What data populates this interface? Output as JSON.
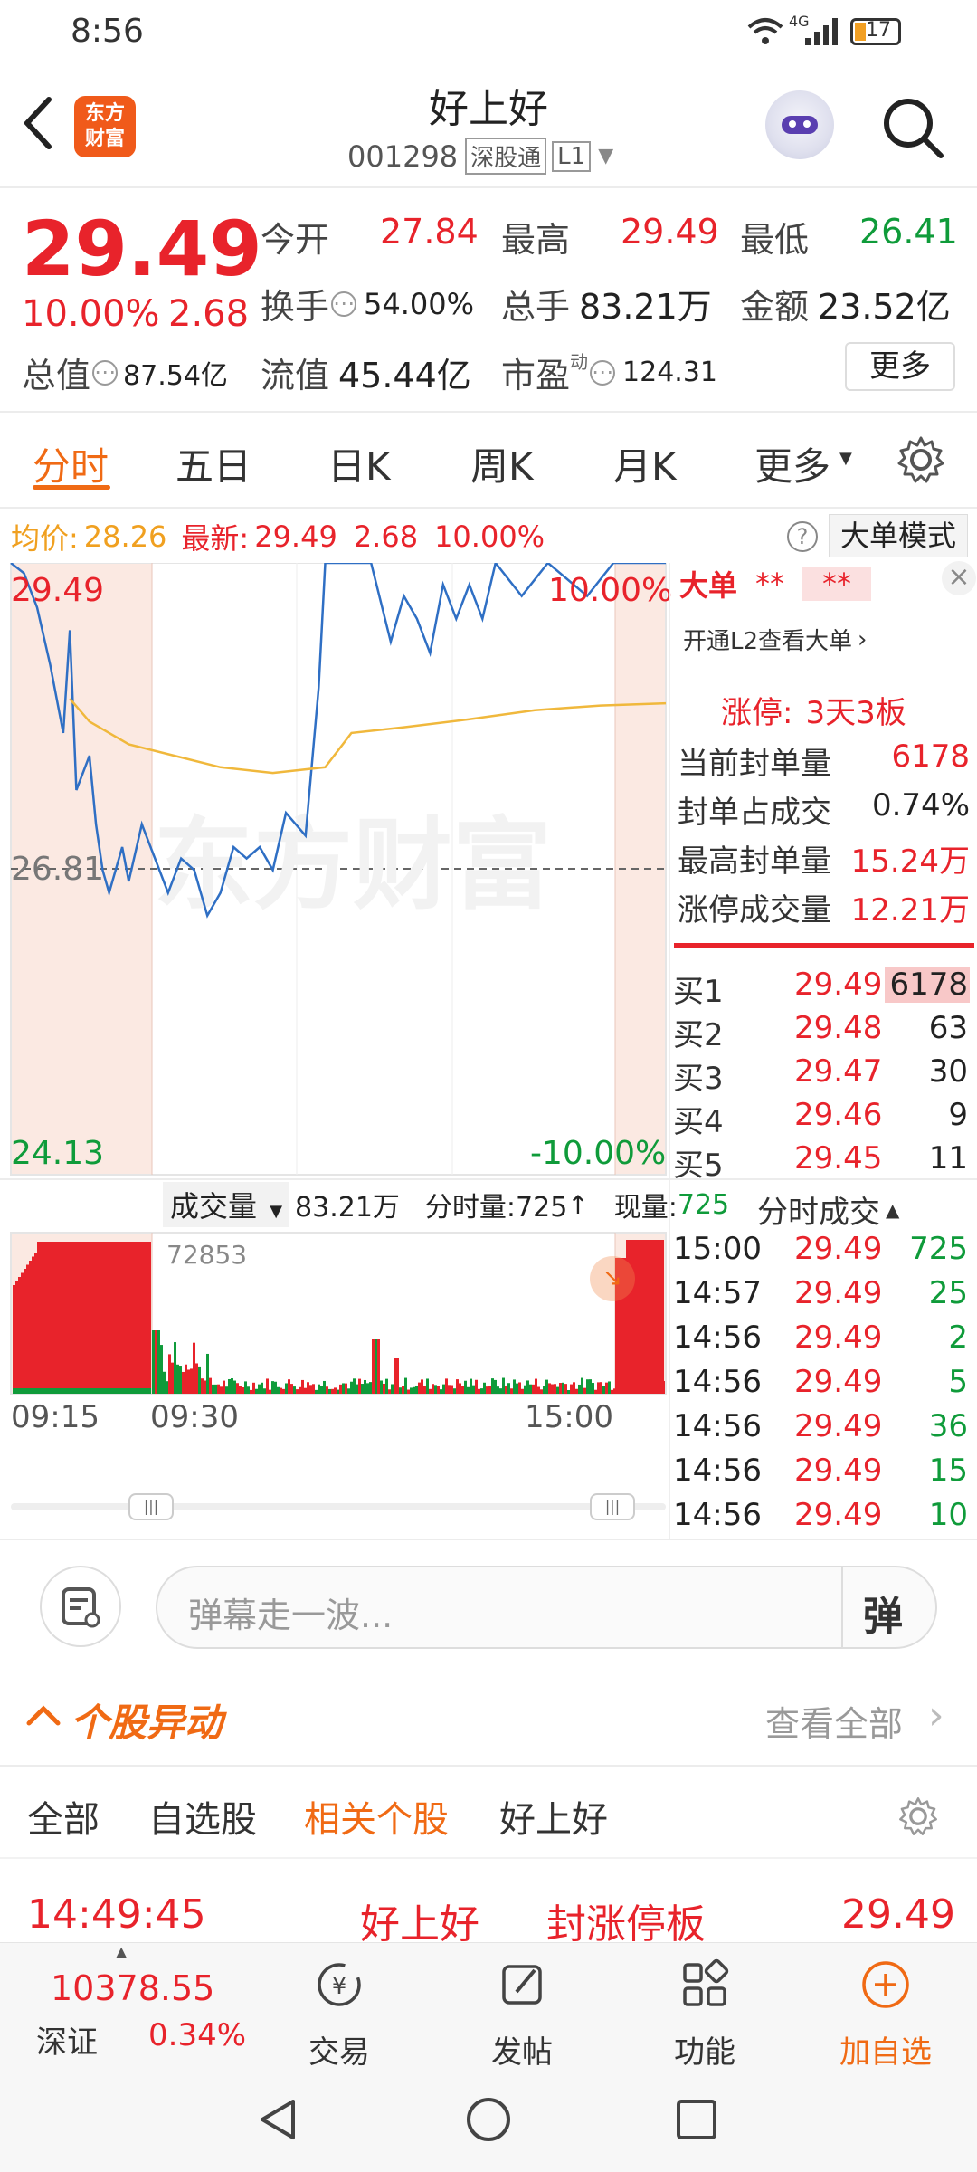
{
  "status_bar": {
    "time": "8:56",
    "network": "4G",
    "battery": "17"
  },
  "header": {
    "logo_line1": "东方",
    "logo_line2": "财富",
    "title": "好上好",
    "code": "001298",
    "exchange_tag": "深股通",
    "level_tag": "L1"
  },
  "quote": {
    "price": "29.49",
    "change_pct": "10.00%",
    "change": "2.68",
    "open_label": "今开",
    "open": "27.84",
    "high_label": "最高",
    "high": "29.49",
    "low_label": "最低",
    "low": "26.41",
    "turnover_label": "换手",
    "turnover": "54.00%",
    "volume_label": "总手",
    "volume": "83.21万",
    "amount_label": "金额",
    "amount": "23.52亿",
    "mcap_label": "总值",
    "mcap": "87.54亿",
    "float_label": "流值",
    "float": "45.44亿",
    "pe_label": "市盈",
    "pe_sup": "动",
    "pe": "124.31",
    "more_button": "更多"
  },
  "chart_tabs": [
    "分时",
    "五日",
    "日K",
    "周K",
    "月K",
    "更多"
  ],
  "info_bar": {
    "avg_label": "均价:",
    "avg": "28.26",
    "latest_label": "最新:",
    "latest": "29.49",
    "chg": "2.68",
    "pct": "10.00%",
    "mode_button": "大单模式"
  },
  "chart_labels": {
    "top_price": "29.49",
    "top_pct": "10.00%",
    "mid_price": "26.81",
    "bottom_price": "24.13",
    "bottom_pct": "-10.00%",
    "vol_selector": "成交量",
    "vol_total": "83.21万",
    "vol_min_label": "分时量:725",
    "vol_now_label": "现量:",
    "vol_now": "725",
    "vol_max": "72853",
    "time_start": "09:15",
    "time_open": "09:30",
    "time_end": "15:00"
  },
  "chart_data": {
    "type": "line",
    "title": "",
    "ylim": [
      24.13,
      29.49
    ],
    "reference": 26.81,
    "series": [
      {
        "name": "",
        "points": [
          [
            0,
            29.49
          ],
          [
            0.02,
            29.4
          ],
          [
            0.04,
            29.1
          ],
          [
            0.06,
            28.6
          ],
          [
            0.08,
            28.0
          ],
          [
            0.09,
            28.9
          ],
          [
            0.1,
            27.5
          ],
          [
            0.12,
            27.8
          ],
          [
            0.13,
            27.2
          ],
          [
            0.14,
            26.8
          ],
          [
            0.15,
            26.6
          ],
          [
            0.17,
            27.0
          ],
          [
            0.18,
            26.7
          ],
          [
            0.2,
            27.2
          ],
          [
            0.22,
            26.9
          ],
          [
            0.24,
            26.6
          ],
          [
            0.26,
            26.9
          ],
          [
            0.28,
            26.8
          ],
          [
            0.3,
            26.4
          ],
          [
            0.32,
            26.6
          ],
          [
            0.34,
            27.0
          ],
          [
            0.36,
            26.9
          ],
          [
            0.38,
            27.0
          ],
          [
            0.4,
            26.8
          ],
          [
            0.42,
            27.3
          ],
          [
            0.45,
            27.1
          ],
          [
            0.47,
            28.4
          ],
          [
            0.48,
            29.49
          ],
          [
            0.52,
            29.49
          ],
          [
            0.55,
            29.49
          ],
          [
            0.58,
            28.8
          ],
          [
            0.6,
            29.2
          ],
          [
            0.62,
            29.0
          ],
          [
            0.64,
            28.7
          ],
          [
            0.66,
            29.3
          ],
          [
            0.68,
            29.0
          ],
          [
            0.7,
            29.3
          ],
          [
            0.72,
            29.0
          ],
          [
            0.74,
            29.49
          ],
          [
            0.78,
            29.2
          ],
          [
            0.82,
            29.49
          ],
          [
            0.88,
            29.2
          ],
          [
            0.92,
            29.49
          ],
          [
            1,
            29.49
          ]
        ]
      },
      {
        "name": "",
        "points": [
          [
            0.09,
            28.3
          ],
          [
            0.12,
            28.1
          ],
          [
            0.18,
            27.9
          ],
          [
            0.25,
            27.8
          ],
          [
            0.32,
            27.7
          ],
          [
            0.4,
            27.65
          ],
          [
            0.48,
            27.7
          ],
          [
            0.52,
            28.0
          ],
          [
            0.6,
            28.05
          ],
          [
            0.7,
            28.12
          ],
          [
            0.8,
            28.2
          ],
          [
            0.9,
            28.24
          ],
          [
            1,
            28.26
          ]
        ]
      }
    ]
  },
  "big_order": {
    "title": "大单",
    "stars1": "**",
    "stars2": "**",
    "l2_link": "开通L2查看大单",
    "limit_up_label": "涨停:",
    "limit_up_value": "3天3板",
    "rows": [
      {
        "label": "当前封单量",
        "value": "6178"
      },
      {
        "label": "封单占成交",
        "value": "0.74%"
      },
      {
        "label": "最高封单量",
        "value": "15.24万"
      },
      {
        "label": "涨停成交量",
        "value": "12.21万"
      }
    ]
  },
  "order_book": [
    {
      "label": "买1",
      "price": "29.49",
      "qty": "6178"
    },
    {
      "label": "买2",
      "price": "29.48",
      "qty": "63"
    },
    {
      "label": "买3",
      "price": "29.47",
      "qty": "30"
    },
    {
      "label": "买4",
      "price": "29.46",
      "qty": "9"
    },
    {
      "label": "买5",
      "price": "29.45",
      "qty": "11"
    }
  ],
  "ticks": {
    "title": "分时成交",
    "rows": [
      {
        "time": "15:00",
        "price": "29.49",
        "qty": "725"
      },
      {
        "time": "14:57",
        "price": "29.49",
        "qty": "25"
      },
      {
        "time": "14:56",
        "price": "29.49",
        "qty": "2"
      },
      {
        "time": "14:56",
        "price": "29.49",
        "qty": "5"
      },
      {
        "time": "14:56",
        "price": "29.49",
        "qty": "36"
      },
      {
        "time": "14:56",
        "price": "29.49",
        "qty": "15"
      },
      {
        "time": "14:56",
        "price": "29.49",
        "qty": "10"
      }
    ]
  },
  "comment": {
    "placeholder": "弹幕走一波...",
    "danmu_button": "弹"
  },
  "news": {
    "section_title": "个股异动",
    "see_all": "查看全部",
    "tabs": [
      "全部",
      "自选股",
      "相关个股",
      "好上好"
    ],
    "row": {
      "time": "14:49:45",
      "name": "好上好",
      "event": "封涨停板",
      "price": "29.49"
    }
  },
  "bottom_bar": {
    "index_value": "10378.55",
    "index_name": "深证",
    "index_pct": "0.34%",
    "items": [
      "交易",
      "发帖",
      "功能",
      "加自选"
    ]
  },
  "colors": {
    "up": "#e8232b",
    "down": "#0f9b3a",
    "accent": "#f06a14",
    "avg_line": "#f0b83c",
    "price_line": "#2f6fc4"
  }
}
